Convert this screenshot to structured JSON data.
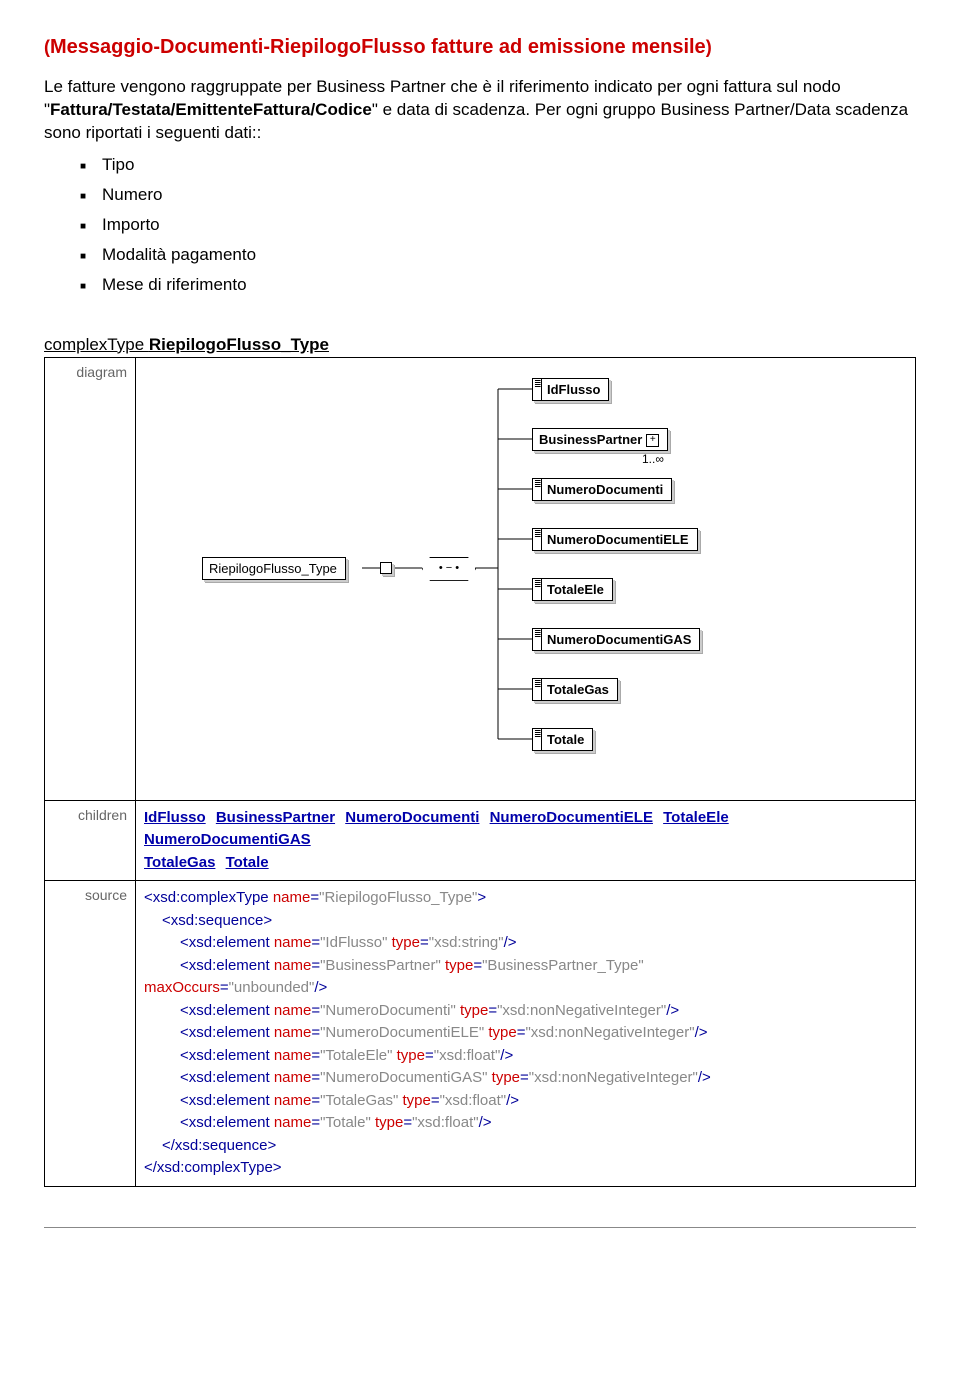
{
  "title": "Messaggio-Documenti-RiepilogoFlusso fatture ad emissione mensile",
  "intro1": "Le fatture vengono raggruppate per Business Partner che è il riferimento indicato per ogni fattura sul nodo \"",
  "intro_bold": "Fattura/Testata/EmittenteFattura/Codice",
  "intro2": "\" e data di scadenza. Per ogni gruppo Business Partner/Data scadenza sono riportati i seguenti dati::",
  "bullets": [
    "Tipo",
    "Numero",
    "Importo",
    "Modalità pagamento",
    "Mese di riferimento"
  ],
  "ctype_prefix": "complexType ",
  "ctype_name": "RiepilogoFlusso_Type",
  "labels": {
    "diagram": "diagram",
    "children": "children",
    "source": "source"
  },
  "children_links": [
    "IdFlusso",
    "BusinessPartner",
    "NumeroDocumenti",
    "NumeroDocumentiELE",
    "TotaleEle",
    "NumeroDocumentiGAS",
    "TotaleGas",
    "Totale"
  ],
  "diagram": {
    "root": "RiepilogoFlusso_Type",
    "sequence": "•−•−•",
    "elements": [
      {
        "name": "IdFlusso",
        "bp": false
      },
      {
        "name": "BusinessPartner",
        "bp": true,
        "cardinality": "1..∞"
      },
      {
        "name": "NumeroDocumenti",
        "bp": false
      },
      {
        "name": "NumeroDocumentiELE",
        "bp": false
      },
      {
        "name": "TotaleEle",
        "bp": false
      },
      {
        "name": "NumeroDocumentiGAS",
        "bp": false
      },
      {
        "name": "TotaleGas",
        "bp": false
      },
      {
        "name": "Totale",
        "bp": false
      }
    ]
  },
  "source_lines": [
    {
      "indent": 0,
      "parts": [
        {
          "t": "tag",
          "v": "<xsd:complexType"
        },
        {
          "t": "sp"
        },
        {
          "t": "attrn",
          "v": "name"
        },
        {
          "t": "eq",
          "v": "="
        },
        {
          "t": "attrv",
          "v": "\"RiepilogoFlusso_Type\""
        },
        {
          "t": "tag",
          "v": ">"
        }
      ]
    },
    {
      "indent": 1,
      "parts": [
        {
          "t": "tag",
          "v": "<xsd:sequence>"
        }
      ]
    },
    {
      "indent": 2,
      "parts": [
        {
          "t": "tag",
          "v": "<xsd:element"
        },
        {
          "t": "sp"
        },
        {
          "t": "attrn",
          "v": "name"
        },
        {
          "t": "eq",
          "v": "="
        },
        {
          "t": "attrv",
          "v": "\"IdFlusso\""
        },
        {
          "t": "sp"
        },
        {
          "t": "attrn",
          "v": "type"
        },
        {
          "t": "eq",
          "v": "="
        },
        {
          "t": "attrv",
          "v": "\"xsd:string\""
        },
        {
          "t": "tag",
          "v": "/>"
        }
      ]
    },
    {
      "indent": 2,
      "parts": [
        {
          "t": "tag",
          "v": "<xsd:element"
        },
        {
          "t": "sp"
        },
        {
          "t": "attrn",
          "v": "name"
        },
        {
          "t": "eq",
          "v": "="
        },
        {
          "t": "attrv",
          "v": "\"BusinessPartner\""
        },
        {
          "t": "sp"
        },
        {
          "t": "attrn",
          "v": "type"
        },
        {
          "t": "eq",
          "v": "="
        },
        {
          "t": "attrv",
          "v": "\"BusinessPartner_Type\""
        }
      ]
    },
    {
      "indent": 0,
      "parts": [
        {
          "t": "attrn",
          "v": "maxOccurs"
        },
        {
          "t": "eq",
          "v": "="
        },
        {
          "t": "attrv",
          "v": "\"unbounded\""
        },
        {
          "t": "tag",
          "v": "/>"
        }
      ]
    },
    {
      "indent": 2,
      "parts": [
        {
          "t": "tag",
          "v": "<xsd:element"
        },
        {
          "t": "sp"
        },
        {
          "t": "attrn",
          "v": "name"
        },
        {
          "t": "eq",
          "v": "="
        },
        {
          "t": "attrv",
          "v": "\"NumeroDocumenti\""
        },
        {
          "t": "sp"
        },
        {
          "t": "attrn",
          "v": "type"
        },
        {
          "t": "eq",
          "v": "="
        },
        {
          "t": "attrv",
          "v": "\"xsd:nonNegativeInteger\""
        },
        {
          "t": "tag",
          "v": "/>"
        }
      ]
    },
    {
      "indent": 2,
      "parts": [
        {
          "t": "tag",
          "v": "<xsd:element"
        },
        {
          "t": "sp"
        },
        {
          "t": "attrn",
          "v": "name"
        },
        {
          "t": "eq",
          "v": "="
        },
        {
          "t": "attrv",
          "v": "\"NumeroDocumentiELE\""
        },
        {
          "t": "sp"
        },
        {
          "t": "attrn",
          "v": "type"
        },
        {
          "t": "eq",
          "v": "="
        },
        {
          "t": "attrv",
          "v": "\"xsd:nonNegativeInteger\""
        },
        {
          "t": "tag",
          "v": "/>"
        }
      ]
    },
    {
      "indent": 2,
      "parts": [
        {
          "t": "tag",
          "v": "<xsd:element"
        },
        {
          "t": "sp"
        },
        {
          "t": "attrn",
          "v": "name"
        },
        {
          "t": "eq",
          "v": "="
        },
        {
          "t": "attrv",
          "v": "\"TotaleEle\""
        },
        {
          "t": "sp"
        },
        {
          "t": "attrn",
          "v": "type"
        },
        {
          "t": "eq",
          "v": "="
        },
        {
          "t": "attrv",
          "v": "\"xsd:float\""
        },
        {
          "t": "tag",
          "v": "/>"
        }
      ]
    },
    {
      "indent": 2,
      "parts": [
        {
          "t": "tag",
          "v": "<xsd:element"
        },
        {
          "t": "sp"
        },
        {
          "t": "attrn",
          "v": "name"
        },
        {
          "t": "eq",
          "v": "="
        },
        {
          "t": "attrv",
          "v": "\"NumeroDocumentiGAS\""
        },
        {
          "t": "sp"
        },
        {
          "t": "attrn",
          "v": "type"
        },
        {
          "t": "eq",
          "v": "="
        },
        {
          "t": "attrv",
          "v": "\"xsd:nonNegativeInteger\""
        },
        {
          "t": "tag",
          "v": "/>"
        }
      ]
    },
    {
      "indent": 2,
      "parts": [
        {
          "t": "tag",
          "v": "<xsd:element"
        },
        {
          "t": "sp"
        },
        {
          "t": "attrn",
          "v": "name"
        },
        {
          "t": "eq",
          "v": "="
        },
        {
          "t": "attrv",
          "v": "\"TotaleGas\""
        },
        {
          "t": "sp"
        },
        {
          "t": "attrn",
          "v": "type"
        },
        {
          "t": "eq",
          "v": "="
        },
        {
          "t": "attrv",
          "v": "\"xsd:float\""
        },
        {
          "t": "tag",
          "v": "/>"
        }
      ]
    },
    {
      "indent": 2,
      "parts": [
        {
          "t": "tag",
          "v": "<xsd:element"
        },
        {
          "t": "sp"
        },
        {
          "t": "attrn",
          "v": "name"
        },
        {
          "t": "eq",
          "v": "="
        },
        {
          "t": "attrv",
          "v": "\"Totale\""
        },
        {
          "t": "sp"
        },
        {
          "t": "attrn",
          "v": "type"
        },
        {
          "t": "eq",
          "v": "="
        },
        {
          "t": "attrv",
          "v": "\"xsd:float\""
        },
        {
          "t": "tag",
          "v": "/>"
        }
      ]
    },
    {
      "indent": 1,
      "parts": [
        {
          "t": "tag",
          "v": "</xsd:sequence>"
        }
      ]
    },
    {
      "indent": 0,
      "parts": [
        {
          "t": "tag",
          "v": "</xsd:complexType>"
        }
      ]
    }
  ]
}
